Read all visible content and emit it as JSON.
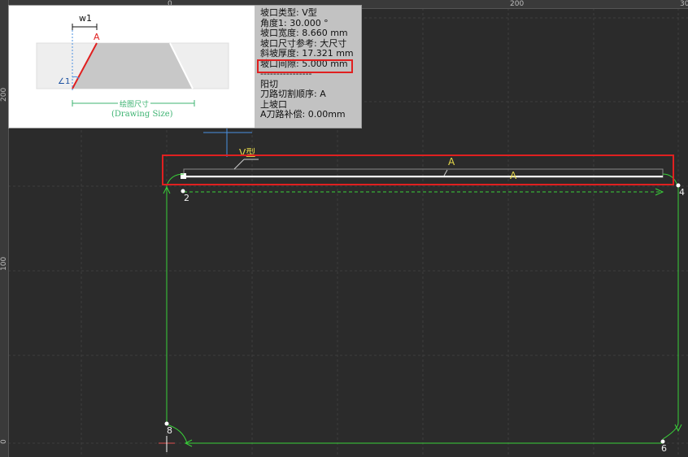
{
  "ruler": {
    "top_labels": [
      "0",
      "200",
      "30"
    ],
    "left_labels": [
      "200",
      "100",
      "0"
    ]
  },
  "info_panel": {
    "lines": [
      "坡口类型: V型",
      "角度1: 30.000 °",
      "坡口宽度: 8.660 mm",
      "坡口尺寸参考: 大尺寸",
      "斜坡厚度: 17.321 mm",
      "坡口间隙: 5.000 mm",
      "----------------",
      "阳切",
      "刀路切割顺序: A",
      "上坡口",
      "A刀路补偿: 0.00mm"
    ],
    "highlighted_line_index": 5,
    "diagram": {
      "width_label": "w1",
      "edge_label": "A",
      "angle_label": "∠1",
      "size_label_cn": "绘图尺寸",
      "size_label_en": "(Drawing Size)"
    }
  },
  "canvas": {
    "bevel_tag": "V型",
    "path_labels": [
      "A",
      "A"
    ],
    "point_labels": [
      "2",
      "4",
      "6",
      "8"
    ]
  },
  "colors": {
    "background": "#2b2b2b",
    "grid": "#3a3a3a",
    "green_path": "#39d139",
    "highlight_red": "#e02020",
    "label_yellow": "#e6d84a",
    "crosshair_blue": "#4a90e2"
  }
}
